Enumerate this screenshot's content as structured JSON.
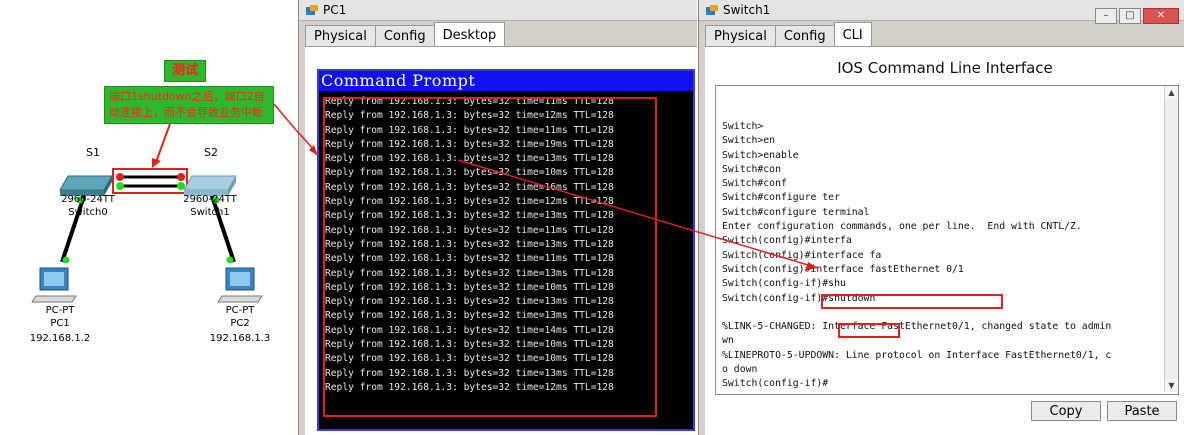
{
  "topology": {
    "test_label": "测试",
    "note": "端口1shutdown之后，端口2自动连接上，而不会导致业务中断",
    "switch0": {
      "tag": "S1",
      "model": "2960-24TT",
      "name": "Switch0"
    },
    "switch1": {
      "tag": "S2",
      "model": "2960-24TT",
      "name": "Switch1"
    },
    "pc1": {
      "type": "PC-PT",
      "name": "PC1",
      "ip": "192.168.1.2"
    },
    "pc2": {
      "type": "PC-PT",
      "name": "PC2",
      "ip": "192.168.1.3"
    }
  },
  "pc_window": {
    "title": "PC1",
    "tabs": [
      "Physical",
      "Config",
      "Desktop"
    ],
    "active_tab": "Desktop",
    "cmd_title": "Command Prompt",
    "lines": [
      "Reply from 192.168.1.3: bytes=32 time=11ms TTL=128",
      "Reply from 192.168.1.3: bytes=32 time=12ms TTL=128",
      "Reply from 192.168.1.3: bytes=32 time=11ms TTL=128",
      "Reply from 192.168.1.3: bytes=32 time=19ms TTL=128",
      "Reply from 192.168.1.3: bytes=32 time=13ms TTL=128",
      "Reply from 192.168.1.3: bytes=32 time=10ms TTL=128",
      "Reply from 192.168.1.3: bytes=32 time=16ms TTL=128",
      "Reply from 192.168.1.3: bytes=32 time=12ms TTL=128",
      "Reply from 192.168.1.3: bytes=32 time=13ms TTL=128",
      "Reply from 192.168.1.3: bytes=32 time=11ms TTL=128",
      "Reply from 192.168.1.3: bytes=32 time=13ms TTL=128",
      "Reply from 192.168.1.3: bytes=32 time=11ms TTL=128",
      "Reply from 192.168.1.3: bytes=32 time=13ms TTL=128",
      "Reply from 192.168.1.3: bytes=32 time=10ms TTL=128",
      "Reply from 192.168.1.3: bytes=32 time=13ms TTL=128",
      "Reply from 192.168.1.3: bytes=32 time=13ms TTL=128",
      "Reply from 192.168.1.3: bytes=32 time=14ms TTL=128",
      "Reply from 192.168.1.3: bytes=32 time=10ms TTL=128",
      "Reply from 192.168.1.3: bytes=32 time=10ms TTL=128",
      "Reply from 192.168.1.3: bytes=32 time=13ms TTL=128",
      "Reply from 192.168.1.3: bytes=32 time=12ms TTL=128"
    ]
  },
  "switch_window": {
    "title": "Switch1",
    "tabs": [
      "Physical",
      "Config",
      "CLI"
    ],
    "active_tab": "CLI",
    "heading": "IOS Command Line Interface",
    "lines": [
      "Switch>",
      "Switch>en",
      "Switch>enable",
      "Switch#con",
      "Switch#conf",
      "Switch#configure ter",
      "Switch#configure terminal",
      "Enter configuration commands, one per line.  End with CNTL/Z.",
      "Switch(config)#interfa",
      "Switch(config)#interface fa",
      "Switch(config)#interface fastEthernet 0/1",
      "Switch(config-if)#shu",
      "Switch(config-if)#shutdown",
      "",
      "%LINK-5-CHANGED: Interface FastEthernet0/1, changed state to admin",
      "wn",
      "%LINEPROTO-5-UPDOWN: Line protocol on Interface FastEthernet0/1, c",
      "o down",
      "Switch(config-if)#"
    ],
    "copy_label": "Copy",
    "paste_label": "Paste"
  },
  "colors": {
    "annotation_red": "#e02020",
    "note_green": "#2eb82e",
    "cmd_blue": "#1010f0"
  },
  "icons": [
    "switch-icon",
    "pc-icon",
    "packet-tracer-app-icon",
    "minimize-icon",
    "maximize-icon",
    "close-icon"
  ]
}
